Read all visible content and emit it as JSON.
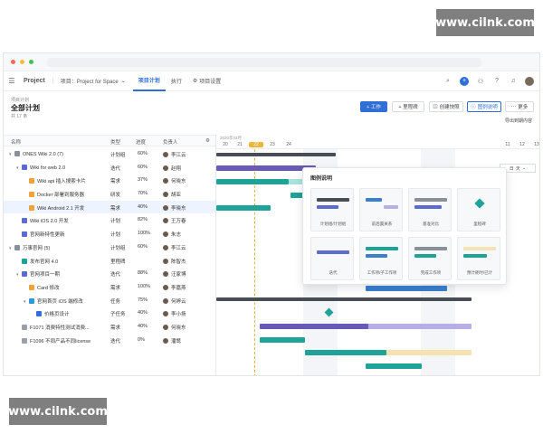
{
  "watermark": {
    "top": "www.cilnk.com",
    "bottom": "www.cilnk.com"
  },
  "topbar": {
    "project_label": "Project",
    "breadcrumb": "项目：Project for Space",
    "tabs": [
      "项目计划",
      "执行",
      "项目设置"
    ],
    "active_tab": 0
  },
  "header": {
    "small_label": "项目计划",
    "title": "全部计划",
    "count": "共 17 条",
    "buttons": {
      "work": "+ 工作",
      "milestone": "+ 里程碑",
      "baseline": "创建快照",
      "legend": "图例说明",
      "more": "更多",
      "export": "导出到期内容"
    }
  },
  "table": {
    "columns": [
      "名称",
      "类型",
      "进度",
      "负责人"
    ],
    "rows": [
      {
        "caret": "▾",
        "indent": 0,
        "icon": "folder-icon",
        "name": "ONES Wiki 2.0 (7)",
        "type": "计划组",
        "progress": "60%",
        "owner": "李江云"
      },
      {
        "caret": "▾",
        "indent": 1,
        "icon": "iteration-icon",
        "name": "Wiki for web 2.0",
        "type": "迭代",
        "progress": "60%",
        "owner": "赵翔"
      },
      {
        "caret": "",
        "indent": 2,
        "icon": "story-icon",
        "name": "Wiki api 插入搜索卡片",
        "type": "需求",
        "progress": "37%",
        "owner": "何晓东"
      },
      {
        "caret": "",
        "indent": 2,
        "icon": "story-icon",
        "name": "Docker 部署到服务器",
        "type": "研发",
        "progress": "70%",
        "owner": "胡亚"
      },
      {
        "caret": "",
        "indent": 2,
        "icon": "story-icon",
        "name": "Wiki Android 2.1 开发",
        "type": "需求",
        "progress": "40%",
        "owner": "李晓东"
      },
      {
        "caret": "",
        "indent": 1,
        "icon": "iteration-icon",
        "name": "Wiki iOS 2.0 开发",
        "type": "计划",
        "progress": "82%",
        "owner": "王万春"
      },
      {
        "caret": "",
        "indent": 1,
        "icon": "iteration-icon",
        "name": "官网新特性更新",
        "type": "计划",
        "progress": "100%",
        "owner": "朱志"
      },
      {
        "caret": "▾",
        "indent": 0,
        "icon": "folder-icon",
        "name": "万事官网 (5)",
        "type": "计划组",
        "progress": "60%",
        "owner": "李江云"
      },
      {
        "caret": "",
        "indent": 1,
        "icon": "milestone-icon",
        "name": "发布官网 4.0",
        "type": "里程碑",
        "progress": "",
        "owner": "陈智杰"
      },
      {
        "caret": "▾",
        "indent": 1,
        "icon": "iteration-icon",
        "name": "官网项目一期",
        "type": "迭代",
        "progress": "88%",
        "owner": "汪家博"
      },
      {
        "caret": "",
        "indent": 2,
        "icon": "story-icon",
        "name": "Card 修改",
        "type": "需求",
        "progress": "100%",
        "owner": "李嘉燕"
      },
      {
        "caret": "▾",
        "indent": 2,
        "icon": "task-icon",
        "name": "官网首页 iOS 端修改",
        "type": "任务",
        "progress": "75%",
        "owner": "何婷云"
      },
      {
        "caret": "",
        "indent": 3,
        "icon": "subtask-icon",
        "name": "价格页设计",
        "type": "子任务",
        "progress": "40%",
        "owner": "李小扬"
      },
      {
        "caret": "",
        "indent": 1,
        "icon": "bug-icon",
        "name": "F1071 消费特性测试消费...",
        "type": "需求",
        "progress": "40%",
        "owner": "何晓东"
      },
      {
        "caret": "",
        "indent": 1,
        "icon": "bug-icon",
        "name": "F1096 不同产品不同license",
        "type": "迭代",
        "progress": "0%",
        "owner": "潘鹜"
      }
    ]
  },
  "gantt": {
    "month_label": "2020年03月",
    "days": [
      "20",
      "21",
      "22",
      "23",
      "24"
    ],
    "right_days": [
      "11",
      "12",
      "13"
    ],
    "today_index": 2,
    "dropdown_label": "天",
    "dropdown_prefix": "日"
  },
  "legend": {
    "title": "图例说明",
    "items": [
      "计划组/计划组",
      "前后置关系",
      "基准对比",
      "里程碑",
      "迭代",
      "工作项/子工作项",
      "完成工作项",
      "预计耗时/已计"
    ]
  },
  "colors": {
    "accent": "#2f6fd6",
    "teal": "#1fa398",
    "purple": "#6a5ab8",
    "lavender": "#b7aee6",
    "gray_bar": "#6f7680",
    "today": "#f0b43a"
  }
}
